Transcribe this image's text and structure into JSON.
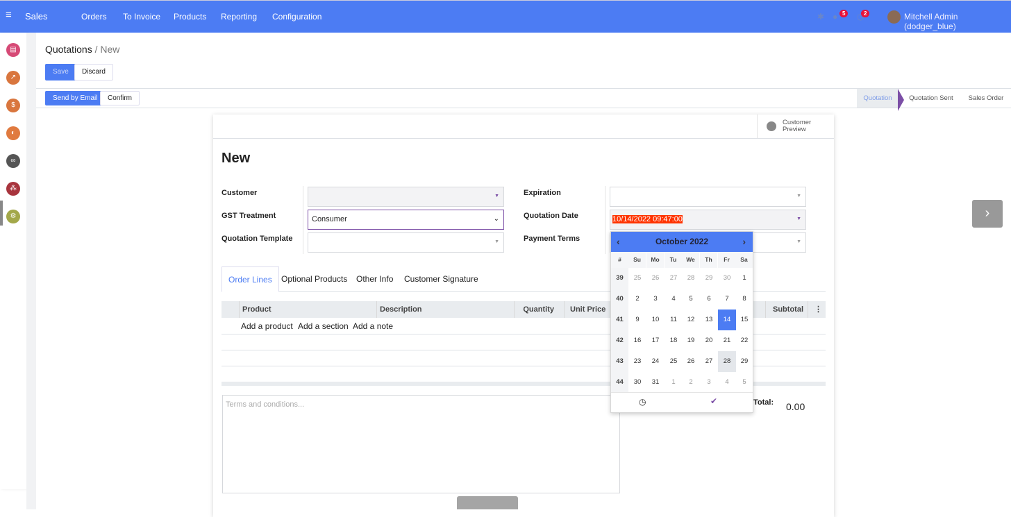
{
  "topbar": {
    "app": "Sales",
    "menu": [
      "Orders",
      "To Invoice",
      "Products",
      "Reporting",
      "Configuration"
    ],
    "messages_count": "5",
    "activities_count": "2",
    "user": "Mitchell Admin (dodger_blue)"
  },
  "breadcrumb": {
    "parent": "Quotations",
    "current": "New"
  },
  "buttons": {
    "save": "Save",
    "discard": "Discard",
    "send_email": "Send by Email",
    "confirm": "Confirm",
    "customer_preview_1": "Customer",
    "customer_preview_2": "Preview"
  },
  "statusbar": [
    "Quotation",
    "Quotation Sent",
    "Sales Order"
  ],
  "form": {
    "title": "New",
    "customer_label": "Customer",
    "customer_value": "",
    "gst_label": "GST Treatment",
    "gst_value": "Consumer",
    "template_label": "Quotation Template",
    "expiration_label": "Expiration",
    "qdate_label": "Quotation Date",
    "qdate_value": "10/14/2022 09:47:00",
    "payment_label": "Payment Terms"
  },
  "tabs": [
    "Order Lines",
    "Optional Products",
    "Other Info",
    "Customer Signature"
  ],
  "table": {
    "headers": [
      "Product",
      "Description",
      "Quantity",
      "Unit Price",
      "Subtotal"
    ],
    "actions": [
      "Add a product",
      "Add a section",
      "Add a note"
    ]
  },
  "terms_placeholder": "Terms and conditions...",
  "total_label": "Total:",
  "total_value": "0.00",
  "calendar": {
    "title": "October 2022",
    "dow": [
      "#",
      "Su",
      "Mo",
      "Tu",
      "We",
      "Th",
      "Fr",
      "Sa"
    ],
    "weeks": [
      [
        "39",
        "25",
        "26",
        "27",
        "28",
        "29",
        "30",
        "1"
      ],
      [
        "40",
        "2",
        "3",
        "4",
        "5",
        "6",
        "7",
        "8"
      ],
      [
        "41",
        "9",
        "10",
        "11",
        "12",
        "13",
        "14",
        "15"
      ],
      [
        "42",
        "16",
        "17",
        "18",
        "19",
        "20",
        "21",
        "22"
      ],
      [
        "43",
        "23",
        "24",
        "25",
        "26",
        "27",
        "28",
        "29"
      ],
      [
        "44",
        "30",
        "31",
        "1",
        "2",
        "3",
        "4",
        "5"
      ]
    ],
    "selected": "14"
  },
  "colors": {
    "brand": "#4c7cf3",
    "highlight": "#ff3300"
  }
}
